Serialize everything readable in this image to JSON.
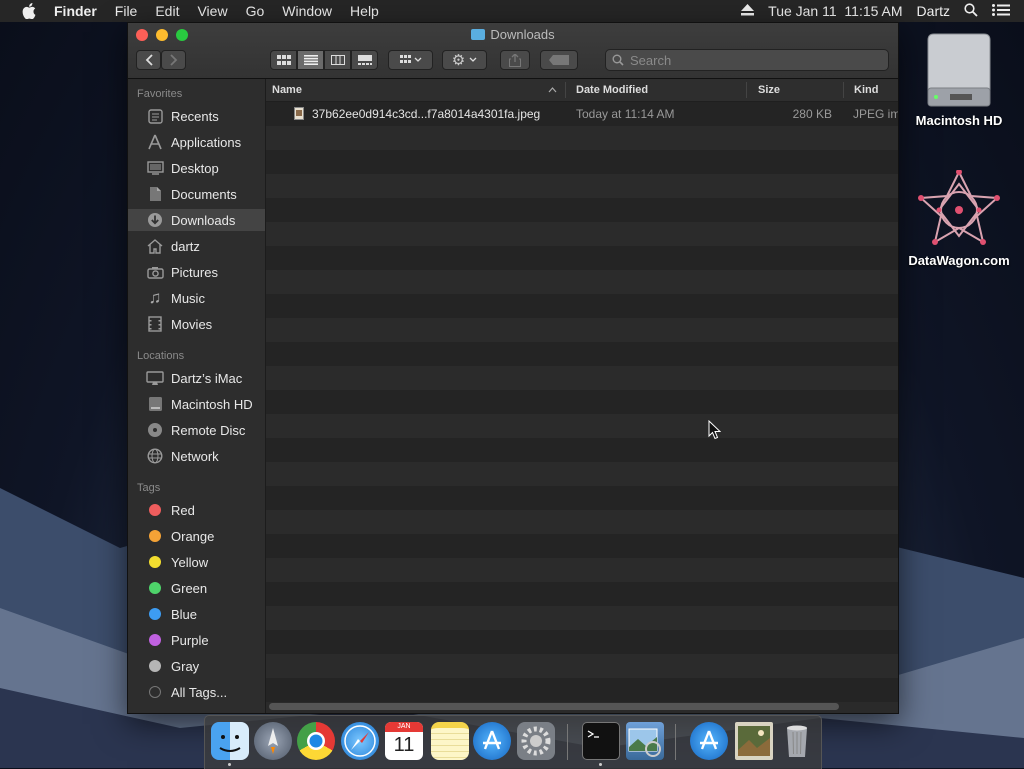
{
  "menubar": {
    "app_name": "Finder",
    "menus": [
      "File",
      "Edit",
      "View",
      "Go",
      "Window",
      "Help"
    ],
    "clock": "Tue Jan 11  11:15 AM",
    "user": "Dartz"
  },
  "window": {
    "title": "Downloads",
    "search_placeholder": "Search"
  },
  "sidebar": {
    "favorites_header": "Favorites",
    "favorites": [
      {
        "label": "Recents",
        "icon": "recents-icon"
      },
      {
        "label": "Applications",
        "icon": "applications-icon"
      },
      {
        "label": "Desktop",
        "icon": "desktop-icon"
      },
      {
        "label": "Documents",
        "icon": "documents-icon"
      },
      {
        "label": "Downloads",
        "icon": "downloads-icon",
        "selected": true
      },
      {
        "label": "dartz",
        "icon": "home-icon"
      },
      {
        "label": "Pictures",
        "icon": "pictures-icon"
      },
      {
        "label": "Music",
        "icon": "music-icon"
      },
      {
        "label": "Movies",
        "icon": "movies-icon"
      }
    ],
    "locations_header": "Locations",
    "locations": [
      {
        "label": "Dartz’s iMac",
        "icon": "imac-icon"
      },
      {
        "label": "Macintosh HD",
        "icon": "disk-icon"
      },
      {
        "label": "Remote Disc",
        "icon": "disc-icon"
      },
      {
        "label": "Network",
        "icon": "network-icon"
      }
    ],
    "tags_header": "Tags",
    "tags": [
      {
        "label": "Red",
        "color": "#ee5d5d"
      },
      {
        "label": "Orange",
        "color": "#f4a236"
      },
      {
        "label": "Yellow",
        "color": "#f2dd2f"
      },
      {
        "label": "Green",
        "color": "#4ed36a"
      },
      {
        "label": "Blue",
        "color": "#3d9cf2"
      },
      {
        "label": "Purple",
        "color": "#c061e0"
      },
      {
        "label": "Gray",
        "color": "#b5b5b5"
      },
      {
        "label": "All Tags...",
        "color": "#555555"
      }
    ]
  },
  "columns": {
    "name": "Name",
    "date": "Date Modified",
    "size": "Size",
    "kind": "Kind"
  },
  "files": [
    {
      "name": "37b62ee0d914c3cd...f7a8014a4301fa.jpeg",
      "date": "Today at 11:14 AM",
      "size": "280 KB",
      "kind": "JPEG im"
    }
  ],
  "desktop": {
    "disk_label": "Macintosh HD",
    "site_label": "DataWagon.com"
  },
  "dock": {
    "apps": [
      "finder-icon",
      "launchpad-icon",
      "chrome-icon",
      "safari-icon",
      "calendar-icon",
      "notes-icon",
      "app-store-icon",
      "system-preferences-icon",
      "terminal-icon",
      "preview-icon",
      "app-store-downloads-icon",
      "image-file-icon",
      "trash-icon"
    ],
    "calendar_month": "JAN",
    "calendar_day": "11"
  }
}
